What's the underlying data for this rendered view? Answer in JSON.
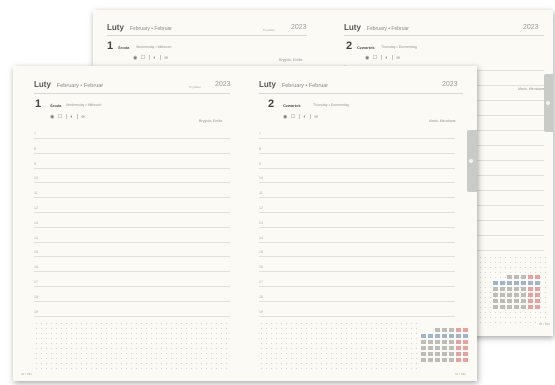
{
  "month": "Luty",
  "month_alt": "February • Februar",
  "year": "2023",
  "week_label": "5 tydzień",
  "days": [
    {
      "num": "1",
      "name": "Środa",
      "alt": "Wednesday • Mittwoch",
      "nameday": "Brygida, Emilia",
      "nameday_back": "Brygida, Emilia"
    },
    {
      "num": "2",
      "name": "Czwartek",
      "alt": "Thursday • Donnerstag",
      "nameday": "Maria, Mirosława"
    }
  ],
  "moon_symbols": "◉ ☐ | ◐ | ∞",
  "hours": [
    "7",
    "8",
    "9",
    "10",
    "11",
    "12",
    "13",
    "14",
    "15",
    "16",
    "17",
    "18",
    "19"
  ],
  "page_numbers": {
    "left": "32 / 333",
    "right": "33 / 333"
  },
  "colors": {
    "paper": "#fbfaf5",
    "tab": "#c9cbc8",
    "weekend": "#e8a0a0",
    "selected_week": "#9eb5cc"
  }
}
